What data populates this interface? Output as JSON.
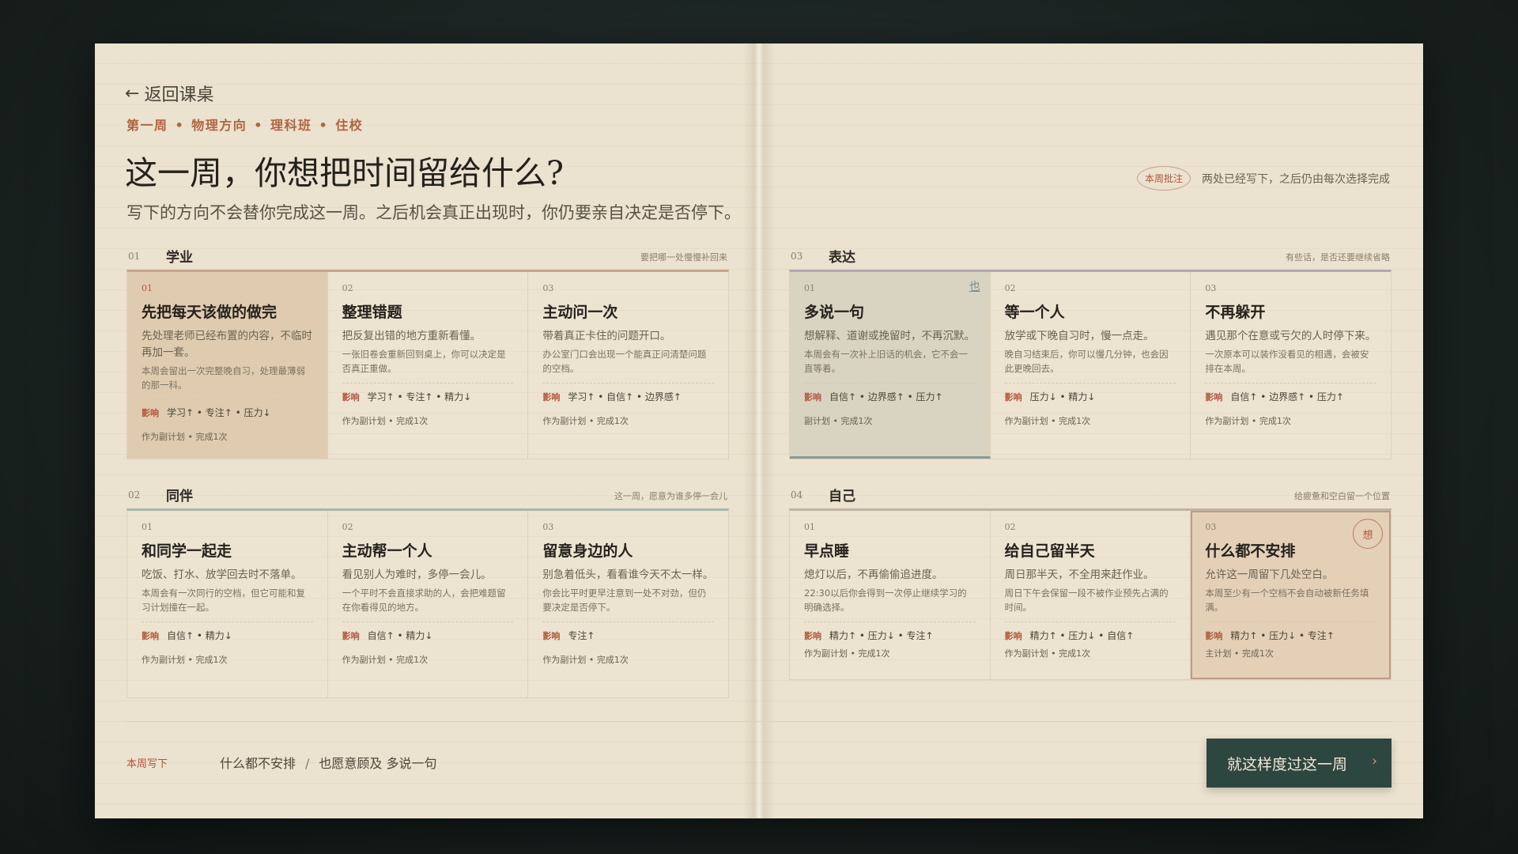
{
  "header": {
    "back_label": "返回课桌",
    "crumbs": [
      "第一周",
      "物理方向",
      "理科班",
      "住校"
    ],
    "title": "这一周，你想把时间留给什么?",
    "subtitle": "写下的方向不会替你完成这一周。之后机会真正出现时，你仍要亲自决定是否停下。",
    "note_stamp": "本周批注",
    "note_text": "两处已经写下，之后仍由每次选择完成"
  },
  "sections": [
    {
      "num": "01",
      "name": "学业",
      "hint": "要把哪一处慢慢补回来",
      "accent": "#c9a48c",
      "cards": [
        {
          "num": "01",
          "title": "先把每天该做的做完",
          "desc": "先处理老师已经布置的内容，不临时再加一套。",
          "detail": "本周会留出一次完整晚自习，处理最薄弱的那一科。",
          "effects": "学习↑ • 专注↑ • 压力↓",
          "meta": "作为副计划 • 完成1次"
        },
        {
          "num": "02",
          "title": "整理错题",
          "desc": "把反复出错的地方重新看懂。",
          "detail": "一张旧卷会重新回到桌上，你可以决定是否真正重做。",
          "effects": "学习↑ • 专注↑ • 精力↓",
          "meta": "作为副计划 • 完成1次"
        },
        {
          "num": "03",
          "title": "主动问一次",
          "desc": "带着真正卡住的问题开口。",
          "detail": "办公室门口会出现一个能真正问清楚问题的空档。",
          "effects": "学习↑ • 自信↑ • 边界感↑",
          "meta": "作为副计划 • 完成1次"
        }
      ]
    },
    {
      "num": "02",
      "name": "同伴",
      "hint": "这一周，愿意为谁多停一会儿",
      "accent": "#a8b6aa",
      "cards": [
        {
          "num": "01",
          "title": "和同学一起走",
          "desc": "吃饭、打水、放学回去时不落单。",
          "detail": "本周会有一次同行的空档，但它可能和复习计划撞在一起。",
          "effects": "自信↑ • 精力↓",
          "meta": "作为副计划 • 完成1次"
        },
        {
          "num": "02",
          "title": "主动帮一个人",
          "desc": "看见别人为难时，多停一会儿。",
          "detail": "一个平时不会直接求助的人，会把难题留在你看得见的地方。",
          "effects": "自信↑ • 精力↓",
          "meta": "作为副计划 • 完成1次"
        },
        {
          "num": "03",
          "title": "留意身边的人",
          "desc": "别急着低头，看看谁今天不太一样。",
          "detail": "你会比平时更早注意到一处不对劲，但仍要决定是否停下。",
          "effects": "专注↑",
          "meta": "作为副计划 • 完成1次"
        }
      ]
    },
    {
      "num": "03",
      "name": "表达",
      "hint": "有些话，是否还要继续省略",
      "accent": "#b4a8b4",
      "cards": [
        {
          "num": "01",
          "title": "多说一句",
          "desc": "想解释、道谢或挽留时，不再沉默。",
          "detail": "本周会有一次补上旧话的机会，它不会一直等着。",
          "effects": "自信↑ • 边界感↑ • 压力↑",
          "meta": "副计划 • 完成1次",
          "mark": "也"
        },
        {
          "num": "02",
          "title": "等一个人",
          "desc": "放学或下晚自习时，慢一点走。",
          "detail": "晚自习结束后，你可以慢几分钟，也会因此更晚回去。",
          "effects": "压力↓ • 精力↓",
          "meta": "作为副计划 • 完成1次"
        },
        {
          "num": "03",
          "title": "不再躲开",
          "desc": "遇见那个在意或亏欠的人时停下来。",
          "detail": "一次原本可以装作没看见的相遇，会被安排在本周。",
          "effects": "自信↑ • 边界感↑ • 压力↑",
          "meta": "作为副计划 • 完成1次"
        }
      ]
    },
    {
      "num": "04",
      "name": "自己",
      "hint": "给疲惫和空白留一个位置",
      "accent": "#bfb3a4",
      "cards": [
        {
          "num": "01",
          "title": "早点睡",
          "desc": "熄灯以后，不再偷偷追进度。",
          "detail": "22:30以后你会得到一次停止继续学习的明确选择。",
          "effects": "精力↑ • 压力↓ • 专注↑",
          "meta": "作为副计划 • 完成1次"
        },
        {
          "num": "02",
          "title": "给自己留半天",
          "desc": "周日那半天，不全用来赶作业。",
          "detail": "周日下午会保留一段不被作业预先占满的时间。",
          "effects": "精力↑ • 压力↓ • 自信↑",
          "meta": "作为副计划 • 完成1次"
        },
        {
          "num": "03",
          "title": "什么都不安排",
          "desc": "允许这一周留下几处空白。",
          "detail": "本周至少有一个空档不会自动被新任务填满。",
          "effects": "精力↑ • 压力↓ • 专注↑",
          "meta": "主计划 • 完成1次",
          "stamp": "想"
        }
      ]
    }
  ],
  "effects_label": "影响",
  "footer": {
    "label": "本周写下",
    "choice_main": "什么都不安排",
    "choice_sep": "/",
    "choice_sub": "也愿意顾及 多说一句",
    "confirm_label": "就这样度过这一周",
    "confirm_chevron": "›"
  },
  "colors": {
    "accent_red": "#b0563a",
    "button_bg": "#2e4640",
    "paper": "#ebe2cf"
  }
}
